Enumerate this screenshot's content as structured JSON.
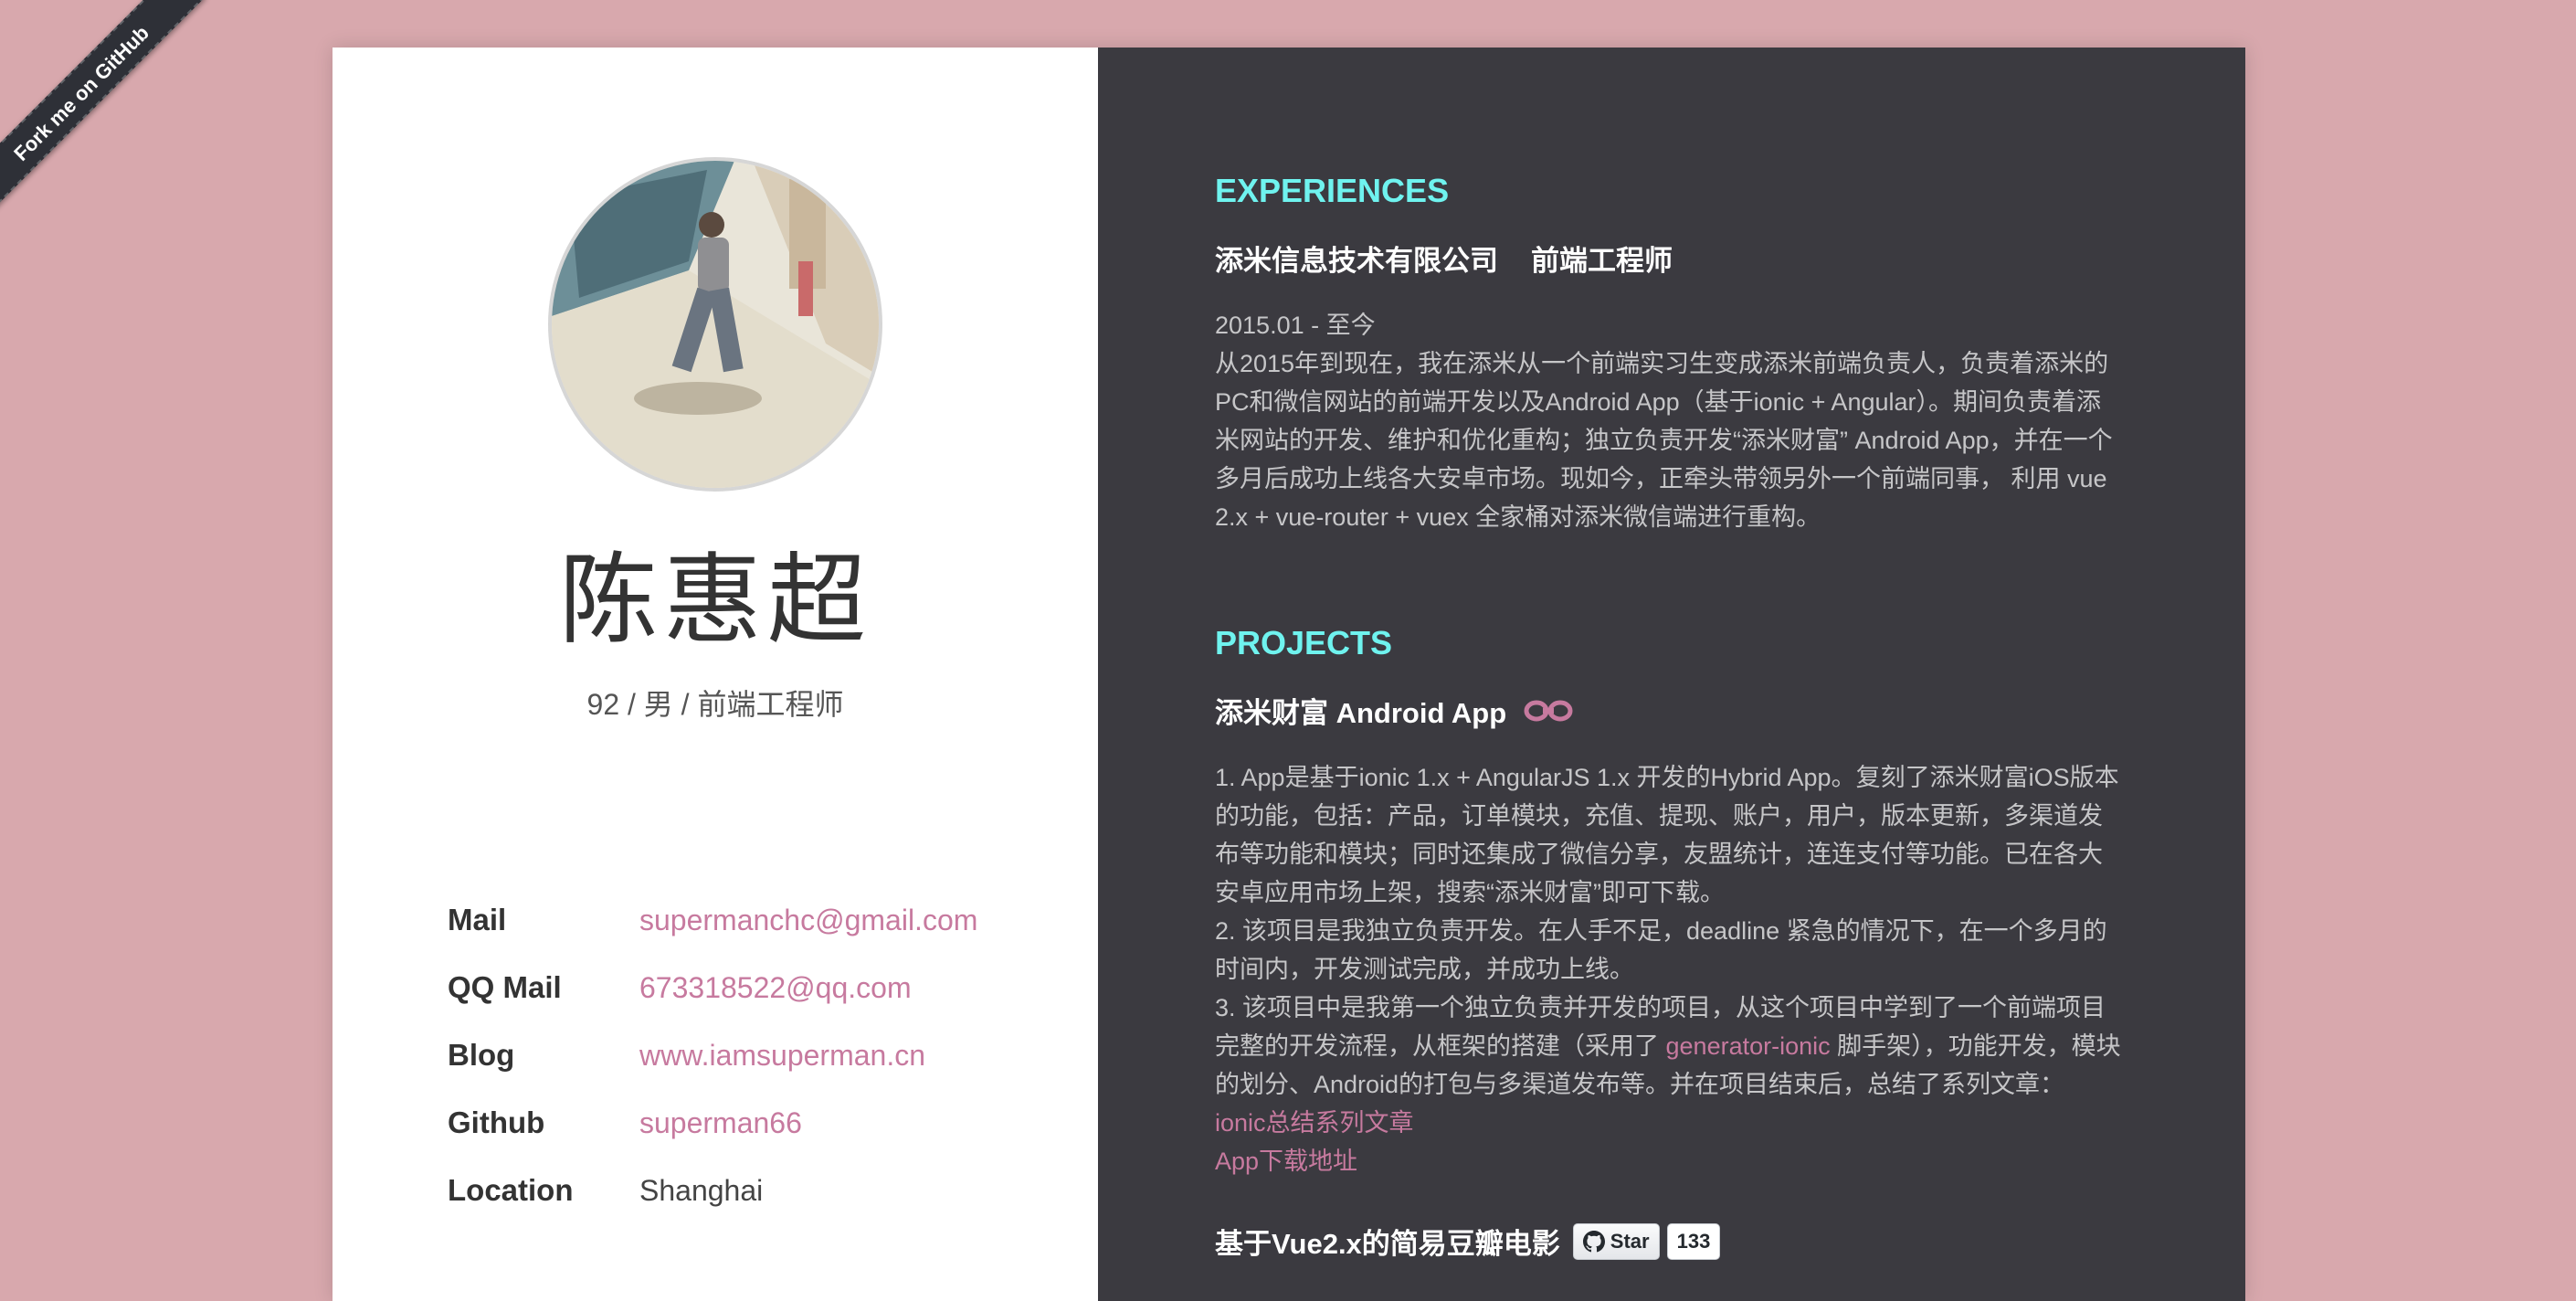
{
  "ribbon": {
    "label": "Fork me on GitHub"
  },
  "profile": {
    "name": "陈惠超",
    "subtitle": "92 / 男 / 前端工程师",
    "contacts": [
      {
        "label": "Mail",
        "value": "supermanchc@gmail.com",
        "link": true
      },
      {
        "label": "QQ Mail",
        "value": "673318522@qq.com",
        "link": true
      },
      {
        "label": "Blog",
        "value": "www.iamsuperman.cn",
        "link": true
      },
      {
        "label": "Github",
        "value": "superman66",
        "link": true
      },
      {
        "label": "Location",
        "value": "Shanghai",
        "link": false
      }
    ]
  },
  "experiences": {
    "title": "EXPERIENCES",
    "company": "添米信息技术有限公司",
    "role": "前端工程师",
    "period": "2015.01 - 至今",
    "description": "从2015年到现在，我在添米从一个前端实习生变成添米前端负责人，负责着添米的PC和微信网站的前端开发以及Android App（基于ionic + Angular）。期间负责着添米网站的开发、维护和优化重构；独立负责开发“添米财富” Android App，并在一个多月后成功上线各大安卓市场。现如今，正牵头带领另外一个前端同事， 利用 vue 2.x + vue-router + vuex 全家桶对添米微信端进行重构。"
  },
  "projects": {
    "title": "PROJECTS",
    "project1": {
      "name": "添米财富 Android App",
      "p1": "1. App是基于ionic 1.x + AngularJS 1.x 开发的Hybrid App。复刻了添米财富iOS版本的功能，包括：产品，订单模块，充值、提现、账户，用户，版本更新，多渠道发布等功能和模块；同时还集成了微信分享，友盟统计，连连支付等功能。已在各大安卓应用市场上架，搜索“添米财富”即可下载。",
      "p2": "2. 该项目是我独立负责开发。在人手不足，deadline 紧急的情况下，在一个多月的时间内，开发测试完成，并成功上线。",
      "p3_before": "3. 该项目中是我第一个独立负责并开发的项目，从这个项目中学到了一个前端项目完整的开发流程，从框架的搭建（采用了 ",
      "p3_link": "generator-ionic",
      "p3_after": " 脚手架），功能开发，模块的划分、Android的打包与多渠道发布等。并在项目结束后，总结了系列文章：",
      "link1": "ionic总结系列文章",
      "link2": "App下载地址"
    },
    "project2": {
      "name": "基于Vue2.x的简易豆瓣电影",
      "star_label": "Star",
      "star_count": "133"
    }
  }
}
